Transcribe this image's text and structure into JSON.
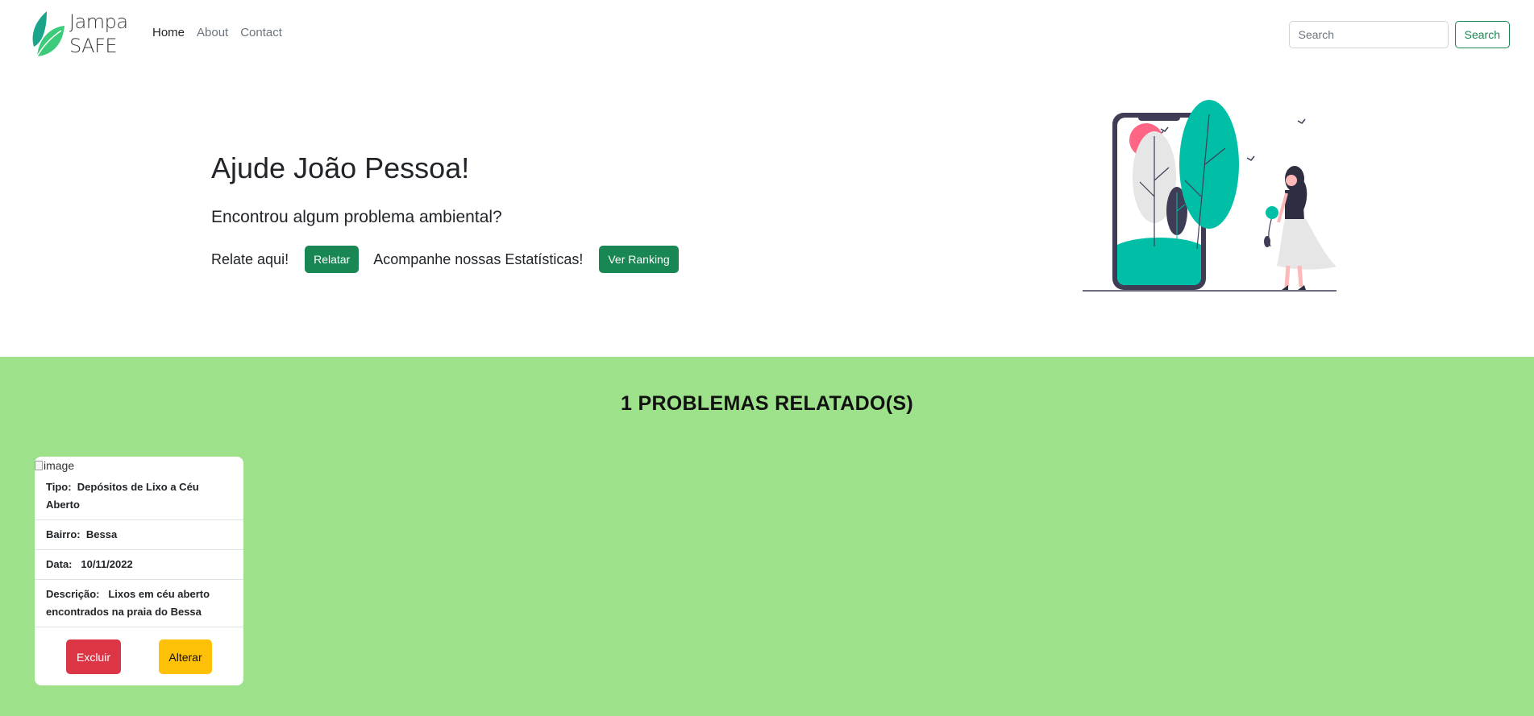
{
  "navbar": {
    "brand_line1": "Jampa",
    "brand_line2": "SAFE",
    "links": [
      "Home",
      "About",
      "Contact"
    ],
    "search": {
      "placeholder": "Search",
      "button_label": "Search"
    }
  },
  "hero": {
    "title": "Ajude João Pessoa!",
    "subtitle": "Encontrou algum problema ambiental?",
    "report_text": "Relate aqui!",
    "report_button": "Relatar",
    "stats_text": "Acompanhe nossas Estatísticas!",
    "ranking_button": "Ver Ranking"
  },
  "reports": {
    "heading": "1 PROBLEMAS RELATADO(S)",
    "cards": [
      {
        "image_alt": "image",
        "tipo_label": "Tipo:",
        "tipo_value": "Depósitos de Lixo a Céu Aberto",
        "bairro_label": "Bairro:",
        "bairro_value": "Bessa",
        "data_label": "Data:",
        "data_value": "10/11/2022",
        "descricao_label": "Descrição:",
        "descricao_value": "Lixos em céu aberto encontrados na praia do Bessa",
        "delete_button": "Excluir",
        "edit_button": "Alterar"
      }
    ]
  },
  "colors": {
    "primary_green": "#198754",
    "section_bg": "#9de18a",
    "danger": "#dc3545",
    "warning": "#ffc107",
    "illustration_teal": "#00bfa6",
    "illustration_pink": "#ff6584"
  }
}
